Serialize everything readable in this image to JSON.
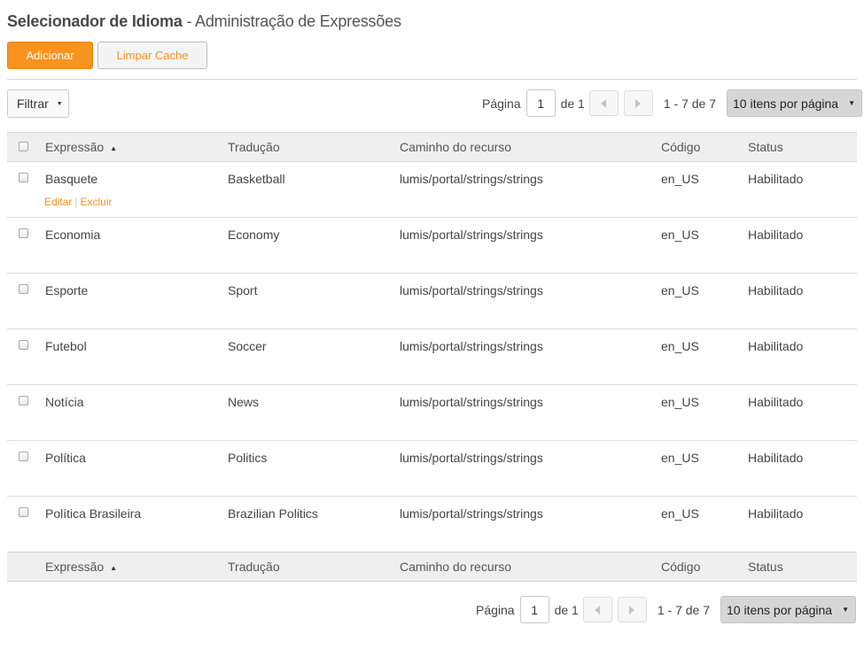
{
  "header": {
    "title_bold": "Selecionador de Idioma",
    "title_rest": " - Administração de Expressões"
  },
  "toolbar": {
    "add_label": "Adicionar",
    "clear_cache_label": "Limpar Cache",
    "filter_label": "Filtrar"
  },
  "pagination": {
    "page_label": "Página",
    "page_value": "1",
    "of_label": "de 1",
    "range": "1 - 7 de 7",
    "per_page": "10 itens por página"
  },
  "table": {
    "columns": [
      "Expressão",
      "Tradução",
      "Caminho do recurso",
      "Código",
      "Status"
    ],
    "row_actions": {
      "edit": "Editar",
      "separator": "|",
      "delete": "Excluir"
    },
    "rows": [
      [
        "Basquete",
        "Basketball",
        "lumis/portal/strings/strings",
        "en_US",
        "Habilitado"
      ],
      [
        "Economia",
        "Economy",
        "lumis/portal/strings/strings",
        "en_US",
        "Habilitado"
      ],
      [
        "Esporte",
        "Sport",
        "lumis/portal/strings/strings",
        "en_US",
        "Habilitado"
      ],
      [
        "Futebol",
        "Soccer",
        "lumis/portal/strings/strings",
        "en_US",
        "Habilitado"
      ],
      [
        "Notícia",
        "News",
        "lumis/portal/strings/strings",
        "en_US",
        "Habilitado"
      ],
      [
        "Política",
        "Politics",
        "lumis/portal/strings/strings",
        "en_US",
        "Habilitado"
      ],
      [
        "Política Brasileira",
        "Brazilian Politics",
        "lumis/portal/strings/strings",
        "en_US",
        "Habilitado"
      ]
    ]
  },
  "colors": {
    "accent": "#f7931e",
    "header_bg": "#efefef",
    "select_bg": "#d6d6d6"
  },
  "icons": {
    "sort": "sort-asc-icon",
    "prev": "chevron-left-icon",
    "next": "chevron-right-icon",
    "dropdown": "caret-down-icon"
  }
}
